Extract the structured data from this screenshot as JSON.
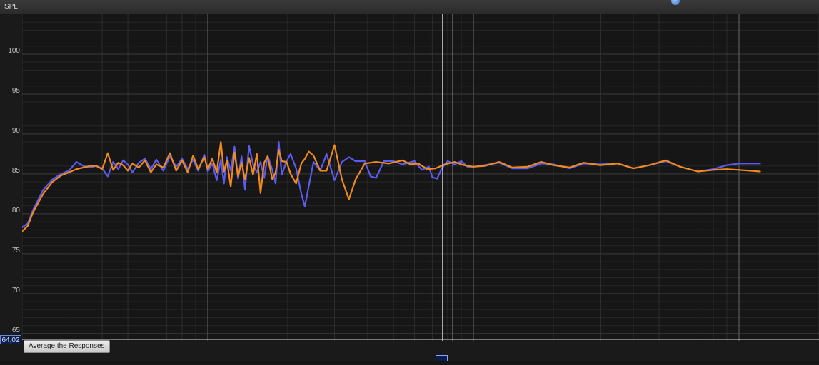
{
  "header": {
    "axis_title": "SPL"
  },
  "readout": {
    "value": "64,02"
  },
  "actions": {
    "average_label": "Average the Responses"
  },
  "colors": {
    "background": "#161616",
    "series_blue": "#5b5bf0",
    "series_orange": "#f08a1e",
    "grid": "#3b3b3b",
    "cursor": "#d8d8d8"
  },
  "chart_data": {
    "type": "line",
    "title": "",
    "xlabel": "",
    "ylabel": "SPL",
    "x_scale": "log",
    "xlim": [
      20,
      20000
    ],
    "ylim": [
      64,
      105
    ],
    "y_ticks": [
      65,
      70,
      75,
      80,
      85,
      90,
      95,
      100
    ],
    "grid": true,
    "series": [
      {
        "color": "#5b5bf0",
        "points": [
          [
            20,
            78.3
          ],
          [
            21,
            78.8
          ],
          [
            22,
            80.5
          ],
          [
            24,
            83
          ],
          [
            26,
            84.3
          ],
          [
            28,
            85
          ],
          [
            30,
            85.4
          ],
          [
            32,
            86.5
          ],
          [
            34,
            86
          ],
          [
            36,
            85.8
          ],
          [
            38,
            86
          ],
          [
            40,
            85.7
          ],
          [
            42,
            84.7
          ],
          [
            44,
            86.5
          ],
          [
            46,
            85.6
          ],
          [
            48,
            86.7
          ],
          [
            50,
            86.2
          ],
          [
            52,
            85.2
          ],
          [
            55,
            86.4
          ],
          [
            58,
            86.9
          ],
          [
            61,
            85.6
          ],
          [
            64,
            86.8
          ],
          [
            68,
            85.4
          ],
          [
            72,
            87.2
          ],
          [
            76,
            85.9
          ],
          [
            80,
            86.9
          ],
          [
            84,
            85.6
          ],
          [
            88,
            86.8
          ],
          [
            92,
            85.4
          ],
          [
            97,
            87.4
          ],
          [
            100,
            85.3
          ],
          [
            104,
            86.3
          ],
          [
            108,
            84.2
          ],
          [
            112,
            86.8
          ],
          [
            115,
            83.8
          ],
          [
            118,
            87.1
          ],
          [
            122,
            85.4
          ],
          [
            126,
            88.4
          ],
          [
            130,
            84.4
          ],
          [
            134,
            87.2
          ],
          [
            138,
            83
          ],
          [
            143,
            88.5
          ],
          [
            148,
            86.2
          ],
          [
            153,
            85.2
          ],
          [
            158,
            86.5
          ],
          [
            163,
            84.5
          ],
          [
            168,
            87.3
          ],
          [
            175,
            85.5
          ],
          [
            180,
            83.8
          ],
          [
            185,
            89
          ],
          [
            190,
            84.9
          ],
          [
            198,
            86.6
          ],
          [
            205,
            87.5
          ],
          [
            215,
            85.7
          ],
          [
            225,
            82.5
          ],
          [
            232,
            80.9
          ],
          [
            240,
            83.5
          ],
          [
            250,
            86.5
          ],
          [
            265,
            85.4
          ],
          [
            280,
            87.5
          ],
          [
            300,
            84.2
          ],
          [
            320,
            86.5
          ],
          [
            340,
            87.1
          ],
          [
            360,
            86.6
          ],
          [
            390,
            86.6
          ],
          [
            410,
            84.7
          ],
          [
            430,
            84.5
          ],
          [
            460,
            86.6
          ],
          [
            500,
            86.6
          ],
          [
            540,
            86.2
          ],
          [
            600,
            86.6
          ],
          [
            640,
            85.5
          ],
          [
            680,
            85.9
          ],
          [
            700,
            84.6
          ],
          [
            730,
            84.4
          ],
          [
            760,
            85.7
          ],
          [
            800,
            86.6
          ],
          [
            850,
            86.2
          ],
          [
            900,
            86.6
          ],
          [
            950,
            85.9
          ],
          [
            1000,
            85.9
          ],
          [
            1100,
            86.1
          ],
          [
            1250,
            86.4
          ],
          [
            1400,
            85.7
          ],
          [
            1600,
            85.7
          ],
          [
            1800,
            86.3
          ],
          [
            2000,
            86.2
          ],
          [
            2300,
            85.7
          ],
          [
            2600,
            86.3
          ],
          [
            3000,
            86.2
          ],
          [
            3500,
            86.3
          ],
          [
            4000,
            85.7
          ],
          [
            4600,
            86.1
          ],
          [
            5300,
            86.6
          ],
          [
            6000,
            85.9
          ],
          [
            7000,
            85.3
          ],
          [
            8000,
            85.6
          ],
          [
            9000,
            86.1
          ],
          [
            10000,
            86.3
          ],
          [
            11000,
            86.3
          ],
          [
            12000,
            86.3
          ]
        ]
      },
      {
        "color": "#f08a1e",
        "points": [
          [
            20,
            77.8
          ],
          [
            21,
            78.5
          ],
          [
            22,
            80.2
          ],
          [
            24,
            82.5
          ],
          [
            26,
            84
          ],
          [
            28,
            84.8
          ],
          [
            30,
            85.2
          ],
          [
            32,
            85.6
          ],
          [
            34,
            85.8
          ],
          [
            36,
            86
          ],
          [
            38,
            86
          ],
          [
            40,
            85.6
          ],
          [
            42,
            87.6
          ],
          [
            44,
            85.5
          ],
          [
            46,
            86.4
          ],
          [
            48,
            86.1
          ],
          [
            50,
            85.4
          ],
          [
            52,
            86.3
          ],
          [
            55,
            85.8
          ],
          [
            58,
            86.7
          ],
          [
            61,
            85.2
          ],
          [
            64,
            86.2
          ],
          [
            68,
            85.8
          ],
          [
            72,
            87.6
          ],
          [
            76,
            85.4
          ],
          [
            80,
            86.7
          ],
          [
            84,
            85.2
          ],
          [
            88,
            87.3
          ],
          [
            92,
            85.6
          ],
          [
            97,
            87.1
          ],
          [
            100,
            85.6
          ],
          [
            104,
            86.9
          ],
          [
            108,
            85.2
          ],
          [
            112,
            89
          ],
          [
            115,
            85.3
          ],
          [
            118,
            86.7
          ],
          [
            122,
            83.4
          ],
          [
            126,
            87.7
          ],
          [
            130,
            84.7
          ],
          [
            134,
            86.4
          ],
          [
            138,
            84.3
          ],
          [
            143,
            87
          ],
          [
            148,
            84.9
          ],
          [
            153,
            87.5
          ],
          [
            158,
            82.6
          ],
          [
            163,
            86.4
          ],
          [
            168,
            87.2
          ],
          [
            175,
            84.3
          ],
          [
            180,
            85.2
          ],
          [
            185,
            88
          ],
          [
            190,
            86.6
          ],
          [
            198,
            86.5
          ],
          [
            205,
            85
          ],
          [
            215,
            83.8
          ],
          [
            225,
            86.3
          ],
          [
            232,
            86.9
          ],
          [
            240,
            87.8
          ],
          [
            250,
            87.3
          ],
          [
            265,
            85.4
          ],
          [
            280,
            85.4
          ],
          [
            300,
            88.6
          ],
          [
            320,
            84.3
          ],
          [
            340,
            81.8
          ],
          [
            360,
            84.3
          ],
          [
            390,
            86.3
          ],
          [
            430,
            86.5
          ],
          [
            480,
            86.3
          ],
          [
            540,
            86.7
          ],
          [
            580,
            86.2
          ],
          [
            620,
            86.3
          ],
          [
            670,
            85.6
          ],
          [
            720,
            85.7
          ],
          [
            780,
            86.2
          ],
          [
            850,
            86.5
          ],
          [
            900,
            86.2
          ],
          [
            950,
            86
          ],
          [
            1000,
            85.9
          ],
          [
            1100,
            86
          ],
          [
            1250,
            86.5
          ],
          [
            1400,
            85.8
          ],
          [
            1600,
            85.9
          ],
          [
            1800,
            86.5
          ],
          [
            2000,
            86.1
          ],
          [
            2300,
            85.8
          ],
          [
            2600,
            86.4
          ],
          [
            3000,
            86.1
          ],
          [
            3500,
            86.3
          ],
          [
            4000,
            85.7
          ],
          [
            4600,
            86.1
          ],
          [
            5300,
            86.7
          ],
          [
            6000,
            85.9
          ],
          [
            7000,
            85.3
          ],
          [
            8000,
            85.5
          ],
          [
            9000,
            85.6
          ],
          [
            10000,
            85.5
          ],
          [
            11000,
            85.4
          ],
          [
            12000,
            85.3
          ]
        ]
      }
    ]
  }
}
